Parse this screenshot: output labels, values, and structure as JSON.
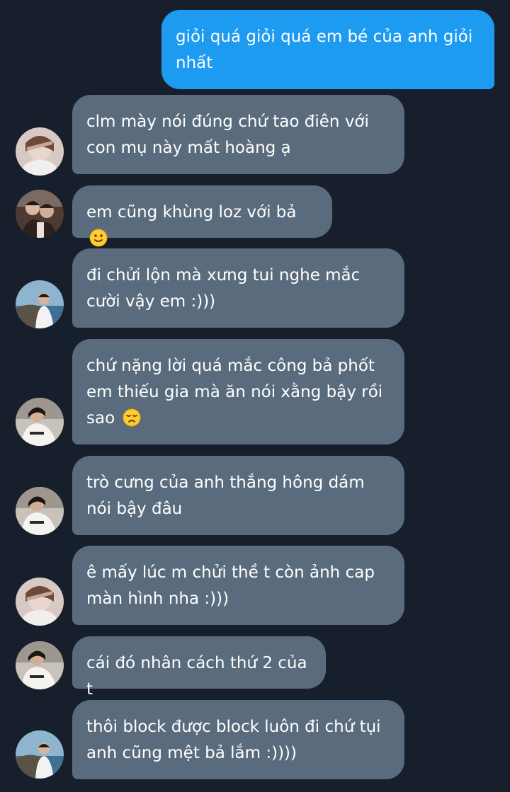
{
  "thread": {
    "messages": [
      {
        "text": "giỏi quá giỏi quá em bé của anh giỏi nhất",
        "emoji": null
      },
      {
        "text": "clm mày nói đúng chứ tao điên với con mụ này mất hoàng ạ",
        "emoji": null
      },
      {
        "text": "em cũng khùng loz với bả",
        "emoji": "slightly-smiling-face"
      },
      {
        "text": "đi chửi lộn mà xưng tui nghe mắc cười vậy em :)))",
        "emoji": null
      },
      {
        "text": "chứ nặng lời quá mắc công bả phốt em thiếu gia mà ăn nói xằng bậy rồi sao",
        "emoji": "disappointed-face"
      },
      {
        "text": "trò cưng của anh thắng hông dám nói bậy đâu",
        "emoji": null
      },
      {
        "text": "ê mấy lúc m chửi thề t còn ảnh cap màn hình nha :)))",
        "emoji": null
      },
      {
        "text": "cái đó nhân cách thứ 2 của t",
        "emoji": null
      },
      {
        "text": "thôi block được block luôn đi chứ tụi anh cũng mệt bả lắm :))))",
        "emoji": null
      }
    ]
  },
  "colors": {
    "background": "#161f2b",
    "incoming_bubble": "#5b6b7e",
    "outgoing_bubble": "#1d9bf0",
    "text": "#ffffff"
  },
  "avatars": [
    "avatar-photo-hoodie",
    "avatar-photo-couple",
    "avatar-photo-seaside",
    "avatar-photo-white-shirt"
  ]
}
